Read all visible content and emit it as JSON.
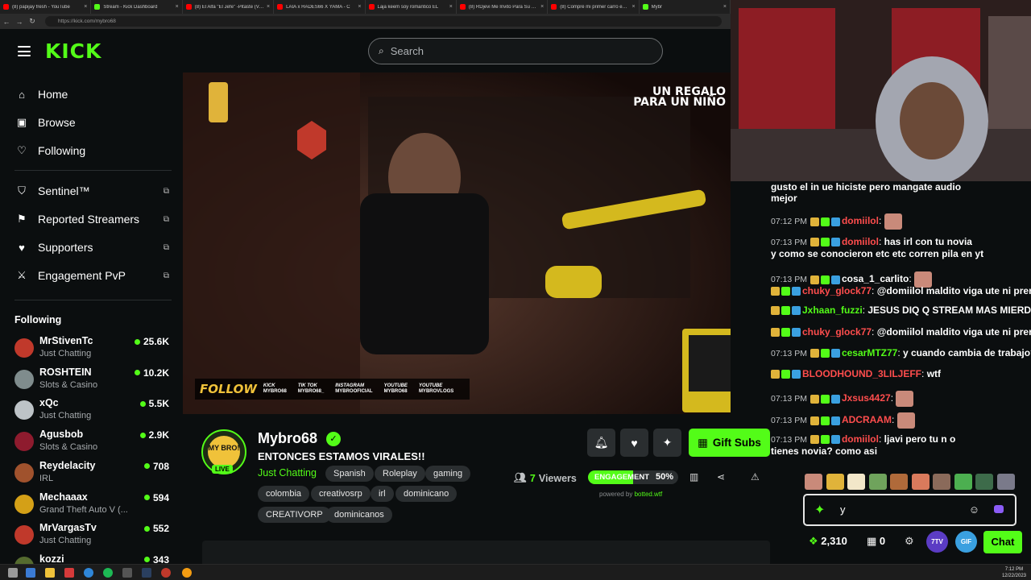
{
  "browser": {
    "tabs": [
      {
        "label": "(8) papijay fresh - YouTube",
        "kind": "yt"
      },
      {
        "label": "Stream - Kick Dashboard",
        "kind": "kick"
      },
      {
        "label": "(8) El Alfa \"El Jefe\" -Pitaste (Video",
        "kind": "yt"
      },
      {
        "label": "LAIA x HADES66 X YAMA - C",
        "kind": "yt"
      },
      {
        "label": "Laja keem soy romantico EL",
        "kind": "yt"
      },
      {
        "label": "(8) RDjevi Me Invito Para Su Univ",
        "kind": "yt"
      },
      {
        "label": "(8) Compré mi primer carro en Re",
        "kind": "yt"
      },
      {
        "label": "Mybr",
        "kind": "kick"
      }
    ],
    "url": "https://kick.com/mybro68"
  },
  "header": {
    "logo": "KICK",
    "search_placeholder": "Search"
  },
  "sidebar": {
    "nav": [
      {
        "label": "Home",
        "icon": "home-icon",
        "glyph": "⌂"
      },
      {
        "label": "Browse",
        "icon": "browse-icon",
        "glyph": "▣"
      },
      {
        "label": "Following",
        "icon": "heart-icon",
        "glyph": "♡"
      }
    ],
    "extra": [
      {
        "label": "Sentinel™",
        "icon": "shield-icon",
        "glyph": "⛉"
      },
      {
        "label": "Reported Streamers",
        "icon": "flag-icon",
        "glyph": "⚑"
      },
      {
        "label": "Supporters",
        "icon": "heart-filled-icon",
        "glyph": "♥"
      },
      {
        "label": "Engagement PvP",
        "icon": "swords-icon",
        "glyph": "⚔"
      }
    ],
    "following_title": "Following",
    "channels": [
      {
        "name": "MrStivenTc",
        "category": "Just Chatting",
        "viewers": "25.6K",
        "color": "#c0392b"
      },
      {
        "name": "ROSHTEIN",
        "category": "Slots & Casino",
        "viewers": "10.2K",
        "color": "#7f8c8d"
      },
      {
        "name": "xQc",
        "category": "Just Chatting",
        "viewers": "5.5K",
        "color": "#bdc3c7"
      },
      {
        "name": "Agusbob",
        "category": "Slots & Casino",
        "viewers": "2.9K",
        "color": "#8e1b2e"
      },
      {
        "name": "Reydelacity",
        "category": "IRL",
        "viewers": "708",
        "color": "#a0522d"
      },
      {
        "name": "Mechaaax",
        "category": "Grand Theft Auto V (...",
        "viewers": "594",
        "color": "#d4a017"
      },
      {
        "name": "MrVargasTv",
        "category": "Just Chatting",
        "viewers": "552",
        "color": "#c0392b"
      },
      {
        "name": "kozzi",
        "category": "",
        "viewers": "343",
        "color": "#556b2f"
      }
    ]
  },
  "video": {
    "overlay_title_1": "UN REGALO",
    "overlay_title_2": "PARA UN NIÑO",
    "follow_text": "FOLLOW",
    "socials": [
      {
        "platform": "KICK",
        "handle": "MYBRO68"
      },
      {
        "platform": "TIK TOK",
        "handle": "MYBRO68_"
      },
      {
        "platform": "INSTAGRAM",
        "handle": "MYBROOFICIAL"
      },
      {
        "platform": "YOUTUBE",
        "handle": "MYBRO68"
      },
      {
        "platform": "YOUTUBE",
        "handle": "MYBROVLOGS"
      }
    ]
  },
  "stream": {
    "avatar_text": "MY BRO!",
    "live_label": "LIVE",
    "name": "Mybro68",
    "title": "ENTONCES ESTAMOS VIRALES!!",
    "category": "Just Chatting",
    "tags_row1": [
      "Spanish",
      "Roleplay",
      "gaming"
    ],
    "tags_row2": [
      "colombia",
      "creativosrp",
      "irl",
      "dominicano"
    ],
    "tags_row3": [
      "CREATIVORP",
      "dominicanos"
    ],
    "gift_subs_label": "Gift Subs",
    "viewers_count": "7",
    "viewers_label": "Viewers",
    "engagement_label": "ENGAGEMENT",
    "engagement_pct": "50%",
    "engagement_value": 50,
    "powered_prefix": "powered by",
    "powered_brand": "botted.wtf"
  },
  "chat": {
    "messages": [
      {
        "time": "",
        "user": "",
        "color": "#53fc18",
        "text": "gusto el in  ue hiciste pero mangate audio"
      },
      {
        "time": "",
        "user": "",
        "color": "#fff",
        "text": "mejor"
      },
      {
        "time": "07:12 PM",
        "user": "domiilol",
        "color": "#ff4d4d",
        "text": ""
      },
      {
        "time": "07:13 PM",
        "user": "domiilol",
        "color": "#ff4d4d",
        "text": "has irl con tu novia"
      },
      {
        "time": "",
        "user": "",
        "color": "#fff",
        "text": "y como se conocieron etc etc corren pila en yt"
      },
      {
        "time": "07:13 PM",
        "user": "cosa_1_carlito",
        "color": "#fff",
        "text": ""
      },
      {
        "time": "",
        "user": "chuky_glock77",
        "color": "#ff4d4d",
        "text": "@domiilol maldito viga ute ni prend"
      },
      {
        "time": "",
        "user": "Jxhaan_fuzzi",
        "color": "#53fc18",
        "text": "JESUS DIQ Q STREAM MAS MIERDA"
      },
      {
        "time": "",
        "user": "chuky_glock77",
        "color": "#ff4d4d",
        "text": "@domiilol maldito viga ute ni prend"
      },
      {
        "time": "07:13 PM",
        "user": "cesarMTZ77",
        "color": "#53fc18",
        "text": "y cuando cambia de trabajo?"
      },
      {
        "time": "",
        "user": "BLOODHOUND_3LILJEFF",
        "color": "#ff4d4d",
        "text": "wtf"
      },
      {
        "time": "07:13 PM",
        "user": "Jxsus4427",
        "color": "#ff4d4d",
        "text": ""
      },
      {
        "time": "07:13 PM",
        "user": "ADCRAAM",
        "color": "#ff4d4d",
        "text": ""
      },
      {
        "time": "07:13 PM",
        "user": "domiilol",
        "color": "#ff4d4d",
        "text": "ljavi pero tu n o"
      },
      {
        "time": "",
        "user": "",
        "color": "#fff",
        "text": "tienes novia? como asi"
      }
    ],
    "input_value": "y",
    "points": "2,310",
    "gift_count": "0",
    "btn_7tv": "7TV",
    "btn_gif": "GIF",
    "send_label": "Chat"
  },
  "taskbar": {
    "time": "7:12 PM",
    "date": "12/22/2023"
  }
}
